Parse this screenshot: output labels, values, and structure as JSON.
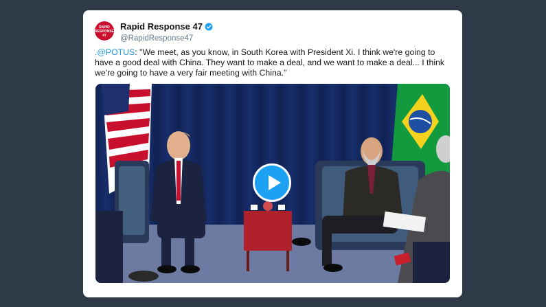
{
  "tweet": {
    "avatar_text": [
      "RAPID",
      "RESPONSE",
      "47"
    ],
    "display_name": "Rapid Response 47",
    "verified": true,
    "handle": "@RapidResponse47",
    "mention": ".@POTUS",
    "text": ": \"We meet, as you know, in South Korea with President Xi. I think we're going to have a good deal with China. They want to make a deal, and we want to make a deal... I think we're going to have a very fair meeting with China.\"",
    "media": {
      "type": "video",
      "play_icon": "play-icon"
    }
  },
  "colors": {
    "page_background": "#2f3a48",
    "card_background": "#ffffff",
    "link": "#1b95e0",
    "play_button": "#1da1f2",
    "avatar": "#c8102e",
    "verified_badge": "#1da1f2"
  }
}
